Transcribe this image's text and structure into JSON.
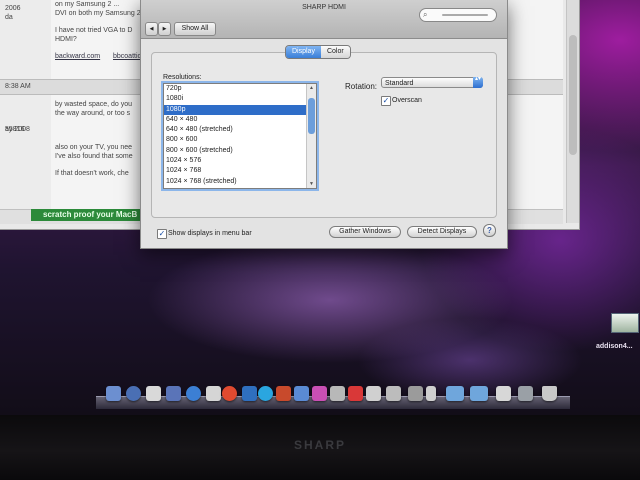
{
  "browser": {
    "left_lines": [
      "2006",
      "da",
      "",
      "",
      "",
      ""
    ],
    "left_time": "8:38 AM",
    "left_meta": [
      "55816",
      "ay 2008"
    ],
    "top_lines": [
      "on my Samsung 2 ...",
      "DVI on both my Samsung 27\" monitor and 42\" LG TV.",
      "I have not tried VGA to D",
      "HDMI?"
    ],
    "links": [
      "backward.com",
      "bbcoattic.co"
    ],
    "post_lines": [
      "by wasted space, do you",
      "the way around, or too s",
      "",
      "also on your TV, you nee",
      "I've also found that some",
      "",
      "If that doesn't work, che"
    ],
    "ad_text": "scratch proof your MacB"
  },
  "prefs": {
    "window_title": "SHARP HDMI",
    "show_all_label": "Show All",
    "tabs": [
      "Display",
      "Color"
    ],
    "resolutions_label": "Resolutions:",
    "resolutions": [
      "720p",
      "1080i",
      "1080p",
      "640 × 480",
      "640 × 480 (stretched)",
      "800 × 600",
      "800 × 600 (stretched)",
      "1024 × 576",
      "1024 × 768",
      "1024 × 768 (stretched)"
    ],
    "selected_resolution": "1080p",
    "rotation_label": "Rotation:",
    "rotation_value": "Standard",
    "overscan_label": "Overscan",
    "overscan_checked": true,
    "show_displays_label": "Show displays in menu bar",
    "show_displays_checked": true,
    "gather_windows_label": "Gather Windows",
    "detect_displays_label": "Detect Displays",
    "help_label": "?"
  },
  "desktop": {
    "icon_label": "addison4..."
  },
  "bezel": {
    "brand": "SHARP"
  },
  "icons": {
    "back": "◀",
    "forward": "▶",
    "check": "✓",
    "search": "⌕",
    "up_down": "▴▾"
  },
  "colors": {
    "selection": "#2e6dc8",
    "tab_active": "#3a7fd8",
    "ad_green": "#2c8a3a"
  }
}
